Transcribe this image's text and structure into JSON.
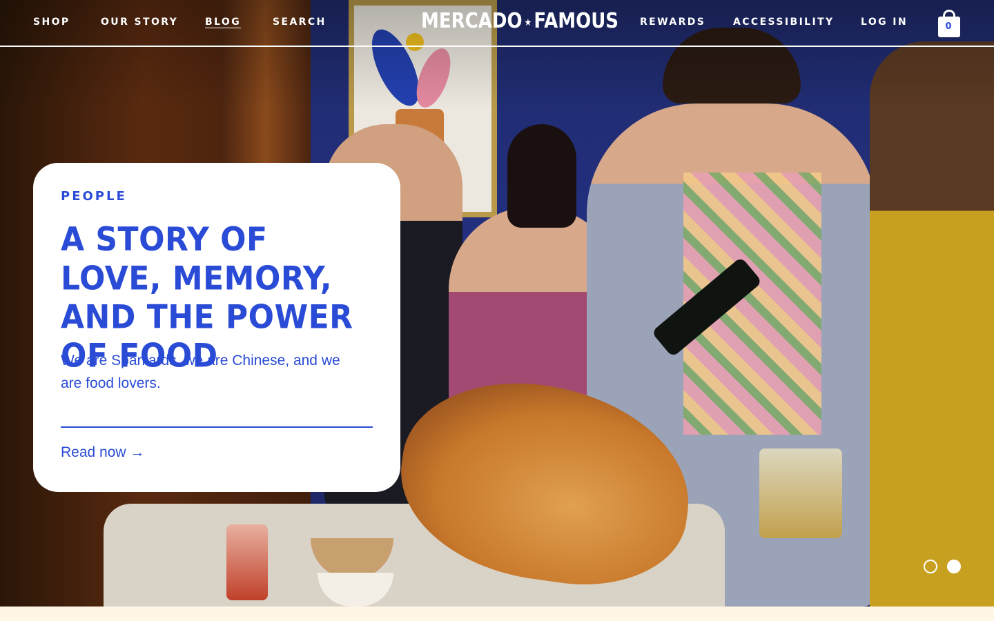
{
  "header": {
    "nav_left": [
      {
        "label": "SHOP"
      },
      {
        "label": "OUR STORY"
      },
      {
        "label": "BLOG",
        "active": true
      },
      {
        "label": "SEARCH"
      }
    ],
    "logo": {
      "word1": "MERCADO",
      "separator": "★",
      "word2": "FAMOUS"
    },
    "nav_right": [
      {
        "label": "REWARDS"
      },
      {
        "label": "ACCESSIBILITY"
      },
      {
        "label": "LOG IN"
      }
    ],
    "cart": {
      "count": "0",
      "icon": "shopping-bag-icon"
    }
  },
  "hero": {
    "card": {
      "eyebrow": "PEOPLE",
      "headline": "A STORY OF LOVE, MEMORY, AND THE POWER OF FOOD",
      "dek": "We are Spaniards, we are Chinese, and we are food lovers.",
      "cta": "Read now →"
    },
    "slides": {
      "total": 2,
      "active": 2
    }
  },
  "colors": {
    "brand_blue": "#2a4bd6",
    "header_text": "#ffffff",
    "card_bg": "#ffffff",
    "page_bg": "#fff9ec"
  }
}
